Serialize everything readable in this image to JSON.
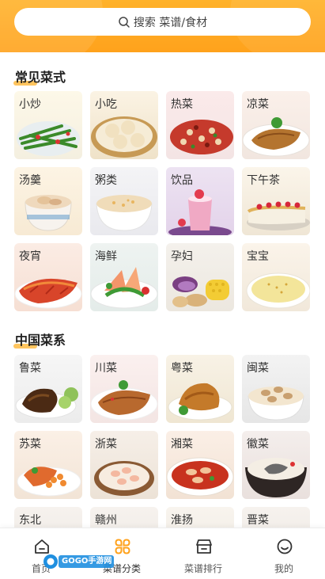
{
  "search": {
    "placeholder": "搜索 菜谱/食材"
  },
  "sections": [
    {
      "title": "常见菜式",
      "items": [
        "小炒",
        "小吃",
        "热菜",
        "凉菜",
        "汤羹",
        "粥类",
        "饮品",
        "下午茶",
        "夜宵",
        "海鲜",
        "孕妇",
        "宝宝"
      ]
    },
    {
      "title": "中国菜系",
      "items": [
        "鲁菜",
        "川菜",
        "粤菜",
        "闽菜",
        "苏菜",
        "浙菜",
        "湘菜",
        "徽菜",
        "东北",
        "赣州",
        "淮扬",
        "晋菜"
      ]
    }
  ],
  "tabs": [
    {
      "label": "首页",
      "icon": "home-icon"
    },
    {
      "label": "菜谱分类",
      "icon": "category-grid-icon"
    },
    {
      "label": "菜谱排行",
      "icon": "ranking-icon"
    },
    {
      "label": "我的",
      "icon": "profile-icon"
    }
  ],
  "watermark": {
    "text": "GOGO手游网"
  },
  "colors": {
    "accent": "#ffb22a",
    "active_tab": "#ffa21c"
  }
}
